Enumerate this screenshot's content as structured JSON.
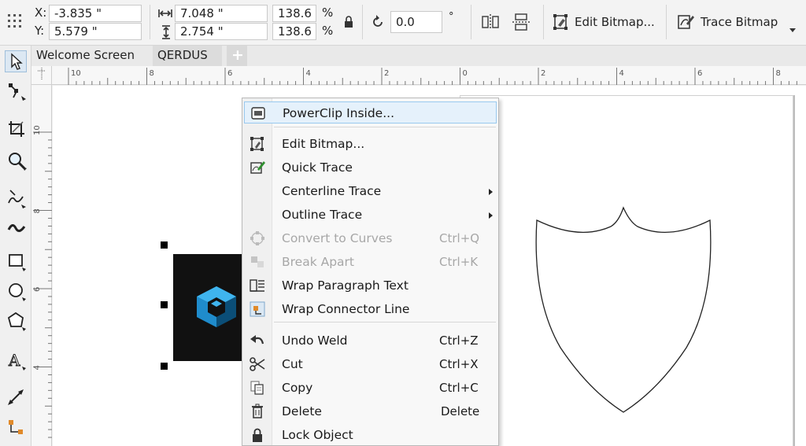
{
  "propbar": {
    "x_label": "X:",
    "x_value": "-3.835 \"",
    "y_label": "Y:",
    "y_value": "5.579 \"",
    "width_value": "7.048 \"",
    "height_value": "2.754 \"",
    "scale_w": "138.6",
    "scale_h": "138.6",
    "percent_w": "%",
    "percent_h": "%",
    "rotation_value": "0.0",
    "degree_symbol": "°",
    "edit_bitmap_label": "Edit Bitmap...",
    "trace_bitmap_label": "Trace Bitmap"
  },
  "tabs": [
    {
      "label": "Welcome Screen"
    },
    {
      "label": "QERDUS"
    }
  ],
  "add_tab": "+",
  "ruler_top_numbers": [
    "10",
    "8",
    "6",
    "4",
    "2",
    "0",
    "2",
    "4",
    "6",
    "8"
  ],
  "ruler_left_numbers": [
    "10",
    "8",
    "6",
    "4"
  ],
  "menu": {
    "items": [
      {
        "label": "PowerClip Inside...",
        "shortcut": "",
        "disabled": false,
        "submenu": false,
        "icon": "powerclip-icon"
      },
      {
        "label": "Edit Bitmap...",
        "shortcut": "",
        "disabled": false,
        "submenu": false,
        "icon": "edit-bitmap-icon"
      },
      {
        "label": "Quick Trace",
        "shortcut": "",
        "disabled": false,
        "submenu": false,
        "icon": "quick-trace-icon"
      },
      {
        "label": "Centerline Trace",
        "shortcut": "",
        "disabled": false,
        "submenu": true,
        "icon": ""
      },
      {
        "label": "Outline Trace",
        "shortcut": "",
        "disabled": false,
        "submenu": true,
        "icon": ""
      },
      {
        "label": "Convert to Curves",
        "shortcut": "Ctrl+Q",
        "disabled": true,
        "submenu": false,
        "icon": "convert-curves-icon"
      },
      {
        "label": "Break Apart",
        "shortcut": "Ctrl+K",
        "disabled": true,
        "submenu": false,
        "icon": "break-apart-icon"
      },
      {
        "label": "Wrap Paragraph Text",
        "shortcut": "",
        "disabled": false,
        "submenu": false,
        "icon": "wrap-text-icon"
      },
      {
        "label": "Wrap Connector Line",
        "shortcut": "",
        "disabled": false,
        "submenu": false,
        "icon": "wrap-connector-icon"
      },
      {
        "label": "Undo Weld",
        "shortcut": "Ctrl+Z",
        "disabled": false,
        "submenu": false,
        "icon": "undo-icon"
      },
      {
        "label": "Cut",
        "shortcut": "Ctrl+X",
        "disabled": false,
        "submenu": false,
        "icon": "scissors-icon"
      },
      {
        "label": "Copy",
        "shortcut": "Ctrl+C",
        "disabled": false,
        "submenu": false,
        "icon": "copy-icon"
      },
      {
        "label": "Delete",
        "shortcut": "Delete",
        "disabled": false,
        "submenu": false,
        "icon": "trash-icon"
      },
      {
        "label": "Lock Object",
        "shortcut": "",
        "disabled": false,
        "submenu": false,
        "icon": "lock-icon"
      }
    ]
  },
  "colors": {
    "accent_blue": "#29a3e0",
    "menu_highlight": "#e5f1fb",
    "menu_highlight_border": "#99c9ef",
    "bitmap_bg": "#111111"
  }
}
